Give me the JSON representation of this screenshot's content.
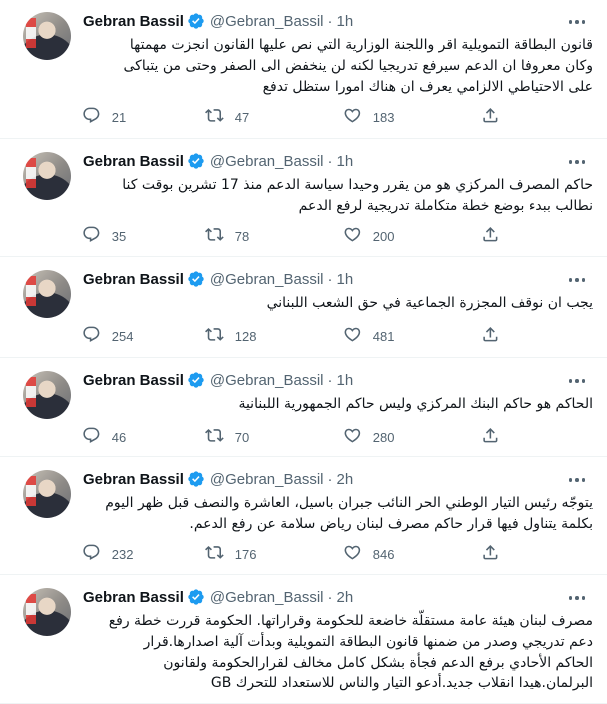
{
  "author": {
    "name": "Gebran Bassil",
    "handle": "@Gebran_Bassil"
  },
  "colors": {
    "text": "#0f1419",
    "secondary": "#536471",
    "verified": "#1d9bf0",
    "divider": "#eff3f4"
  },
  "icons": [
    "verified-badge-icon",
    "more-icon",
    "reply-icon",
    "retweet-icon",
    "like-icon",
    "share-icon"
  ],
  "tweets": [
    {
      "time": "1h",
      "lines": [
        "قانون البطاقة التمويلية اقر واللجنة الوزارية التي نص عليها القانون انجزت مهمتها",
        "وكان معروفا ان الدعم سيرفع تدريجيا لكنه لن ينخفض الى الصفر وحتى من يتباكى",
        "على الاحتياطي الالزامي يعرف ان هناك امورا ستظل تدفع"
      ],
      "replies": "21",
      "retweets": "47",
      "likes": "183"
    },
    {
      "time": "1h",
      "lines": [
        "حاكم المصرف المركزي هو من يقرر وحيدا سياسة الدعم منذ 17 تشرين بوقت كنا",
        "نطالب ببدء بوضع خطة متكاملة تدريجية لرفع الدعم"
      ],
      "replies": "35",
      "retweets": "78",
      "likes": "200"
    },
    {
      "time": "1h",
      "lines": [
        "يجب ان نوقف المجزرة الجماعية في حق الشعب اللبناني"
      ],
      "replies": "254",
      "retweets": "128",
      "likes": "481"
    },
    {
      "time": "1h",
      "lines": [
        "الحاكم هو حاكم البنك المركزي وليس حاكم الجمهورية اللبنانية"
      ],
      "replies": "46",
      "retweets": "70",
      "likes": "280"
    },
    {
      "time": "2h",
      "lines": [
        "يتوجّه رئيس التيار الوطني الحر النائب جبران باسيل، العاشرة والنصف قبل ظهر اليوم",
        "بكلمة يتناول فيها قرار حاكم مصرف لبنان رياض سلامة عن رفع الدعم."
      ],
      "replies": "232",
      "retweets": "176",
      "likes": "846"
    },
    {
      "time": "2h",
      "lines": [
        "مصرف لبنان هيئة عامة مستقلّة خاضعة للحكومة وقراراتها. الحكومة قررت خطة رفع",
        "دعم تدريجي وصدر من ضمنها قانون البطاقة التمويلية وبدأت آلية اصدارها.قرار",
        "الحاكم الأحادي برفع الدعم فجأة بشكل كامل مخالف لقرارالحكومة ولقانون",
        "البرلمان.هيدا انقلاب جديد.أدعو التيار والناس للاستعداد للتحرك GB"
      ],
      "replies": "",
      "retweets": "",
      "likes": ""
    }
  ]
}
